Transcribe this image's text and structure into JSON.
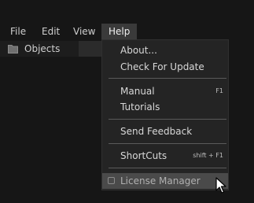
{
  "menubar": {
    "file": "File",
    "edit": "Edit",
    "view": "View",
    "help": "Help"
  },
  "panel": {
    "objects_label": "Objects",
    "folder_icon": "folder-icon"
  },
  "help_menu": {
    "about": "About...",
    "check_update": "Check For Update",
    "manual": "Manual",
    "manual_shortcut": "F1",
    "tutorials": "Tutorials",
    "send_feedback": "Send Feedback",
    "shortcuts": "ShortCuts",
    "shortcuts_shortcut": "shift + F1",
    "license_manager": "License Manager",
    "license_icon": "license-icon"
  },
  "cursor_icon": "mouse-pointer-icon"
}
